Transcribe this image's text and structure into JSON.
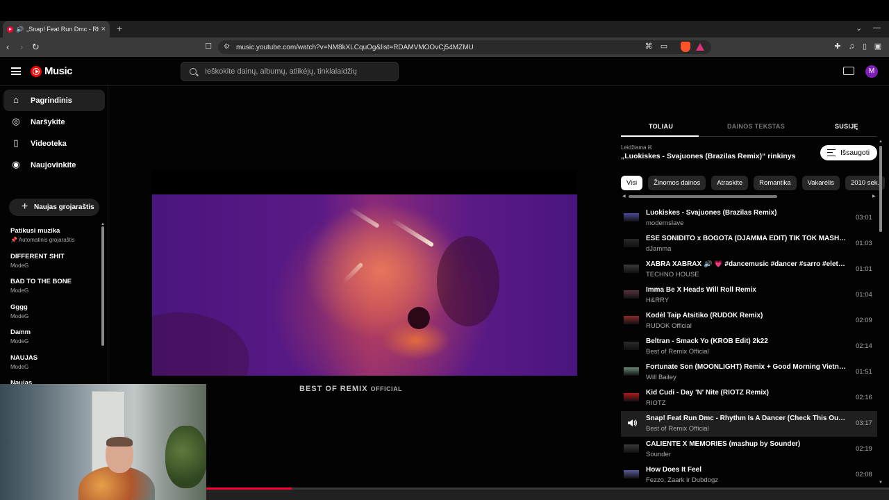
{
  "browser": {
    "tab_title": "„Snap! Feat Run Dmc - Rhythm Is A Dancer",
    "url": "music.youtube.com/watch?v=NM8kXLCquOg&list=RDAMVMOOvCj54MZMU"
  },
  "app": {
    "logo_text": "Music",
    "search_placeholder": "Ieškokite dainų, albumų, atlikėjų, tinklalaidžių",
    "avatar_letter": "M"
  },
  "sidebar": {
    "nav": [
      {
        "label": "Pagrindinis",
        "icon": "home-icon"
      },
      {
        "label": "Naršykite",
        "icon": "compass-icon"
      },
      {
        "label": "Videoteka",
        "icon": "bookmark-icon"
      },
      {
        "label": "Naujovinkite",
        "icon": "upgrade-icon"
      }
    ],
    "new_playlist": "Naujas grojaraštis",
    "playlists": [
      {
        "name": "Patikusi muzika",
        "sub": "Automatinis grojaraštis"
      },
      {
        "name": "DIFFERENT SHIT",
        "sub": "ModeG"
      },
      {
        "name": "BAD TO THE BONE",
        "sub": "ModeG"
      },
      {
        "name": "Gggg",
        "sub": "ModeG"
      },
      {
        "name": "Damm",
        "sub": "ModeG"
      },
      {
        "name": "NAUJAS",
        "sub": "ModeG"
      },
      {
        "name": "Naujas",
        "sub": ""
      }
    ]
  },
  "player": {
    "watermark_main": "BEST OF REMIX",
    "watermark_sub": "OFFICIAL",
    "progress_fraction": 0.328
  },
  "panel": {
    "tabs": [
      "TOLIAU",
      "DAINOS TEKSTAS",
      "SUSIJĘ"
    ],
    "playing_from": "Leidžiama iš",
    "playlist_title": "„Luokiskes - Svajuones (Brazilas Remix)“ rinkinys",
    "save_label": "Išsaugoti",
    "chips": [
      "Visi",
      "Žinomos dainos",
      "Atraskite",
      "Romantika",
      "Vakarėlis",
      "2010 sek."
    ],
    "queue": [
      {
        "title": "Luokiskes - Svajuones (Brazilas Remix)",
        "artist": "modernslave",
        "duration": "03:01",
        "thumb": "#4a4a9a"
      },
      {
        "title": "ESE SONIDITO x BOGOTA (DJAMMA EDIT) TIK TOK MASHUP",
        "artist": "dJamma",
        "duration": "01:03",
        "thumb": "#2a2a2a"
      },
      {
        "title": "XABRA XABRAX 🔊 💗 #dancemusic #dancer #sarro #eletronicmusic",
        "artist": "TECHNO HOUSE",
        "duration": "01:01",
        "thumb": "#3a3a3a"
      },
      {
        "title": "Imma Be X Heads Will Roll Remix",
        "artist": "H&RRY",
        "duration": "01:04",
        "thumb": "#5a3040"
      },
      {
        "title": "Kodėl Taip Atsitiko (RUDOK Remix)",
        "artist": "RUDOK Official",
        "duration": "02:09",
        "thumb": "#8a2a2a"
      },
      {
        "title": "Beltran - Smack Yo (KROB Edit) 2k22",
        "artist": "Best of Remix Official",
        "duration": "02:14",
        "thumb": "#2a2a2a"
      },
      {
        "title": "Fortunate Son (MOONLIGHT) Remix + Good Morning Vietnam",
        "artist": "Will Bailey",
        "duration": "01:51",
        "thumb": "#6a8a7a"
      },
      {
        "title": "Kid Cudi - Day 'N' Nite (RIOTZ Remix)",
        "artist": "RIOTZ",
        "duration": "02:16",
        "thumb": "#b01818"
      },
      {
        "title": "Snap! Feat Run Dmc - Rhythm Is A Dancer (Check This Out) [Best of Remix]",
        "artist": "Best of Remix Official",
        "duration": "03:17",
        "thumb": "#1f1f1f",
        "playing": true
      },
      {
        "title": "CALIENTE X MEMORIES (mashup by Sounder)",
        "artist": "Sounder",
        "duration": "02:19",
        "thumb": "#3a3a3a"
      },
      {
        "title": "How Does It Feel",
        "artist": "Fezzo, Zaark ir Dubdogz",
        "duration": "02:08",
        "thumb": "#5a5a9a"
      }
    ]
  }
}
